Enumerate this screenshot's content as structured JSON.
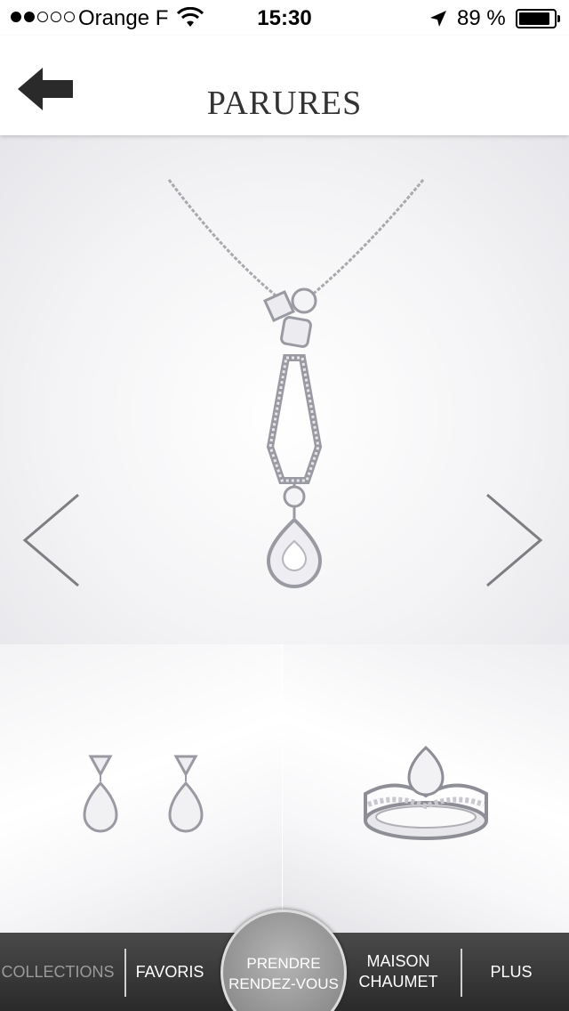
{
  "status_bar": {
    "carrier": "Orange F",
    "time": "15:30",
    "battery": "89 %",
    "battery_level": 0.89,
    "signal_bars_filled": 2,
    "signal_bars_total": 5
  },
  "header": {
    "title": "PARURES",
    "back_icon": "arrow-left-icon"
  },
  "hero": {
    "prev_icon": "chevron-left-icon",
    "next_icon": "chevron-right-icon"
  },
  "tabbar": {
    "collections": "COLLECTIONS",
    "favoris": "FAVORIS",
    "rdv_line1": "PRENDRE",
    "rdv_line2": "RENDEZ-VOUS",
    "maison_line1": "MAISON",
    "maison_line2": "CHAUMET",
    "plus": "PLUS"
  },
  "colors": {
    "tabbar": "#3a3a3a",
    "inactive_tab": "#9a9a9a",
    "title": "#333333"
  }
}
